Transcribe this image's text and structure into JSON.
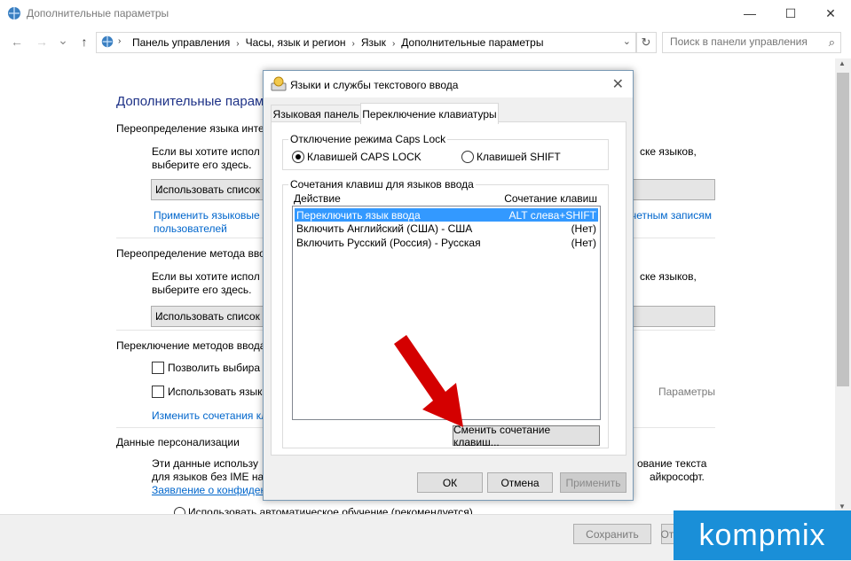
{
  "window": {
    "title": "Дополнительные параметры",
    "minimize": "—",
    "maximize": "☐",
    "close": "✕"
  },
  "nav": {
    "back": "←",
    "forward": "→",
    "dropdown": "⌄",
    "up": "↑",
    "breadcrumbs": [
      "Панель управления",
      "Часы, язык и регион",
      "Язык",
      "Дополнительные параметры"
    ],
    "refresh": "↻",
    "search_placeholder": "Поиск в панели управления",
    "search_icon": "⌕"
  },
  "page": {
    "heading": "Дополнительные парам",
    "s1_title": "Переопределение языка инте",
    "s1_text_l": "Если вы хотите испол",
    "s1_text_l2": "выберите его здесь.",
    "s1_text_r": "ске языков,",
    "s1_combo": "Использовать список",
    "s1_link_l": "Применить языковые",
    "s1_link_l2": "пользователей",
    "s1_link_r": "четным записям",
    "s2_title": "Переопределение метода ввода",
    "s2_text_l": "Если вы хотите испол",
    "s2_text_l2": "выберите его здесь.",
    "s2_text_r": "ске языков,",
    "s2_combo": "Использовать список",
    "s3_title": "Переключение методов ввода",
    "s3_cb1": "Позволить выбира",
    "s3_cb2": "Использовать язык",
    "s3_params": "Параметры",
    "s3_link": "Изменить сочетания кл",
    "s4_title": "Данные персонализации",
    "s4_text_l": "Эти данные использу",
    "s4_text_l2": "для языков без IME на з",
    "s4_text_r": "ование текста",
    "s4_text_r2": "айкрософт.",
    "s4_link": "Заявление о конфиден",
    "s4_radio": "Использовать автоматическое обучение (рекомендуется)"
  },
  "footer": {
    "save": "Сохранить",
    "cancel": "Отмена"
  },
  "dialog": {
    "title": "Языки и службы текстового ввода",
    "close": "✕",
    "tabs": [
      "Языковая панель",
      "Переключение клавиатуры"
    ],
    "caps_group": "Отключение режима Caps Lock",
    "caps_opt1": "Клавишей CAPS LOCK",
    "caps_opt2": "Клавишей SHIFT",
    "hotkeys_group": "Сочетания клавиш для языков ввода",
    "col_action": "Действие",
    "col_keys": "Сочетание клавиш",
    "rows": [
      {
        "action": "Переключить язык ввода",
        "keys": "ALT слева+SHIFT"
      },
      {
        "action": "Включить Английский (США) - США",
        "keys": "(Нет)"
      },
      {
        "action": "Включить Русский (Россия) - Русская",
        "keys": "(Нет)"
      }
    ],
    "change_button": "Сменить сочетание клавиш...",
    "ok": "ОК",
    "cancel": "Отмена",
    "apply": "Применить"
  },
  "watermark": "kompmix",
  "colors": {
    "accent": "#0066cc",
    "selection": "#3399ff",
    "arrow": "#d40000"
  }
}
